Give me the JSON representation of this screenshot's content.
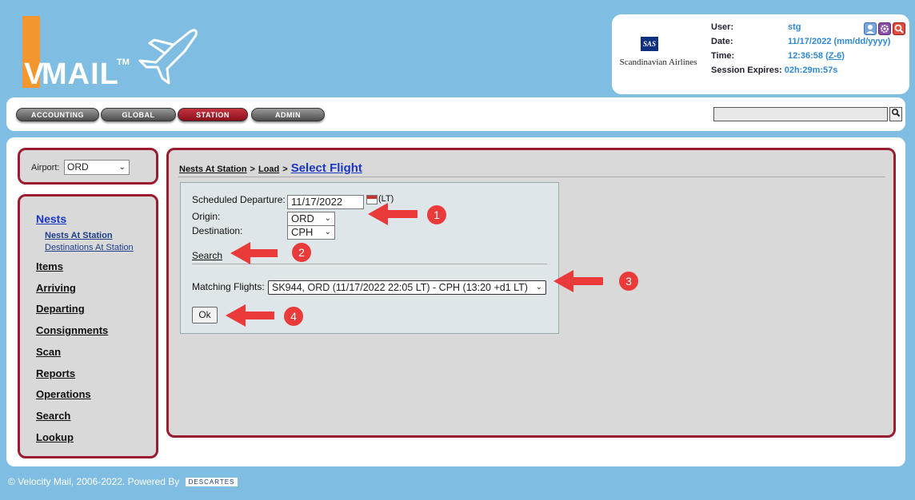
{
  "brand": {
    "logo_v": "V",
    "logo_text": "MAIL",
    "logo_tm": "TM"
  },
  "user_panel": {
    "airline_name": "Scandinavian Airlines",
    "airline_logo": "SAS",
    "user_label": "User:",
    "user_value": "stg",
    "date_label": "Date:",
    "date_value": "11/17/2022 (mm/dd/yyyy)",
    "time_label": "Time:",
    "time_value": "12:36:58 (",
    "time_zone_link": "Z-6",
    "time_close": ")",
    "session_label": "Session Expires:",
    "session_value": "02h:29m:57s",
    "icons": [
      "user-profile-icon",
      "settings-gear-icon",
      "search-tool-icon"
    ]
  },
  "nav_tabs": [
    {
      "label": "ACCOUNTING",
      "active": false
    },
    {
      "label": "GLOBAL",
      "active": false
    },
    {
      "label": "STATION",
      "active": true
    },
    {
      "label": "ADMIN",
      "active": false
    }
  ],
  "global_search": {
    "value": ""
  },
  "airport": {
    "label": "Airport:",
    "value": "ORD"
  },
  "sidebar": {
    "items": [
      {
        "label": "Nests"
      },
      {
        "label": "Nests At Station"
      },
      {
        "label": "Destinations At Station"
      },
      {
        "label": "Items"
      },
      {
        "label": "Arriving"
      },
      {
        "label": "Departing"
      },
      {
        "label": "Consignments"
      },
      {
        "label": "Scan"
      },
      {
        "label": "Reports"
      },
      {
        "label": "Operations"
      },
      {
        "label": "Search"
      },
      {
        "label": "Lookup"
      }
    ]
  },
  "breadcrumb": {
    "part1": "Nests At Station",
    "sep": ">",
    "part2": "Load",
    "current": "Select Flight"
  },
  "form": {
    "scheduled_departure_label": "Scheduled Departure:",
    "scheduled_departure_value": "11/17/2022",
    "tz_suffix": "(LT)",
    "origin_label": "Origin:",
    "origin_value": "ORD",
    "destination_label": "Destination:",
    "destination_value": "CPH",
    "search_link": "Search",
    "matching_label": "Matching Flights:",
    "matching_value": "SK944, ORD (11/17/2022 22:05 LT) - CPH (13:20 +d1 LT)",
    "ok_label": "Ok"
  },
  "annotations": [
    "1",
    "2",
    "3",
    "4"
  ],
  "footer": {
    "text": "© Velocity Mail, 2006-2022. Powered By",
    "brand": "DESCARTES"
  },
  "colors": {
    "accent_red": "#9b1b30",
    "arrow_red": "#ea3a3a",
    "link_blue": "#1b37c2",
    "logo_orange": "#f3962e"
  }
}
